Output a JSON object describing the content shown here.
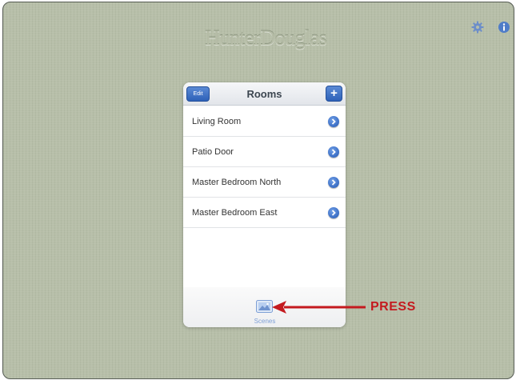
{
  "header": {
    "logo_text": "HunterDouglas",
    "icons": [
      "gear-icon",
      "info-icon"
    ]
  },
  "rooms_panel": {
    "title": "Rooms",
    "edit_label": "Edit",
    "add_label": "+",
    "items": [
      {
        "label": "Living Room"
      },
      {
        "label": "Patio Door"
      },
      {
        "label": "Master Bedroom North"
      },
      {
        "label": "Master Bedroom East"
      }
    ],
    "tab": {
      "label": "Scenes",
      "icon": "scenes-icon"
    }
  },
  "annotation": {
    "label": "PRESS",
    "color": "#c41a1f"
  },
  "colors": {
    "background": "#b7bfa9",
    "accent": "#2d61b8"
  }
}
